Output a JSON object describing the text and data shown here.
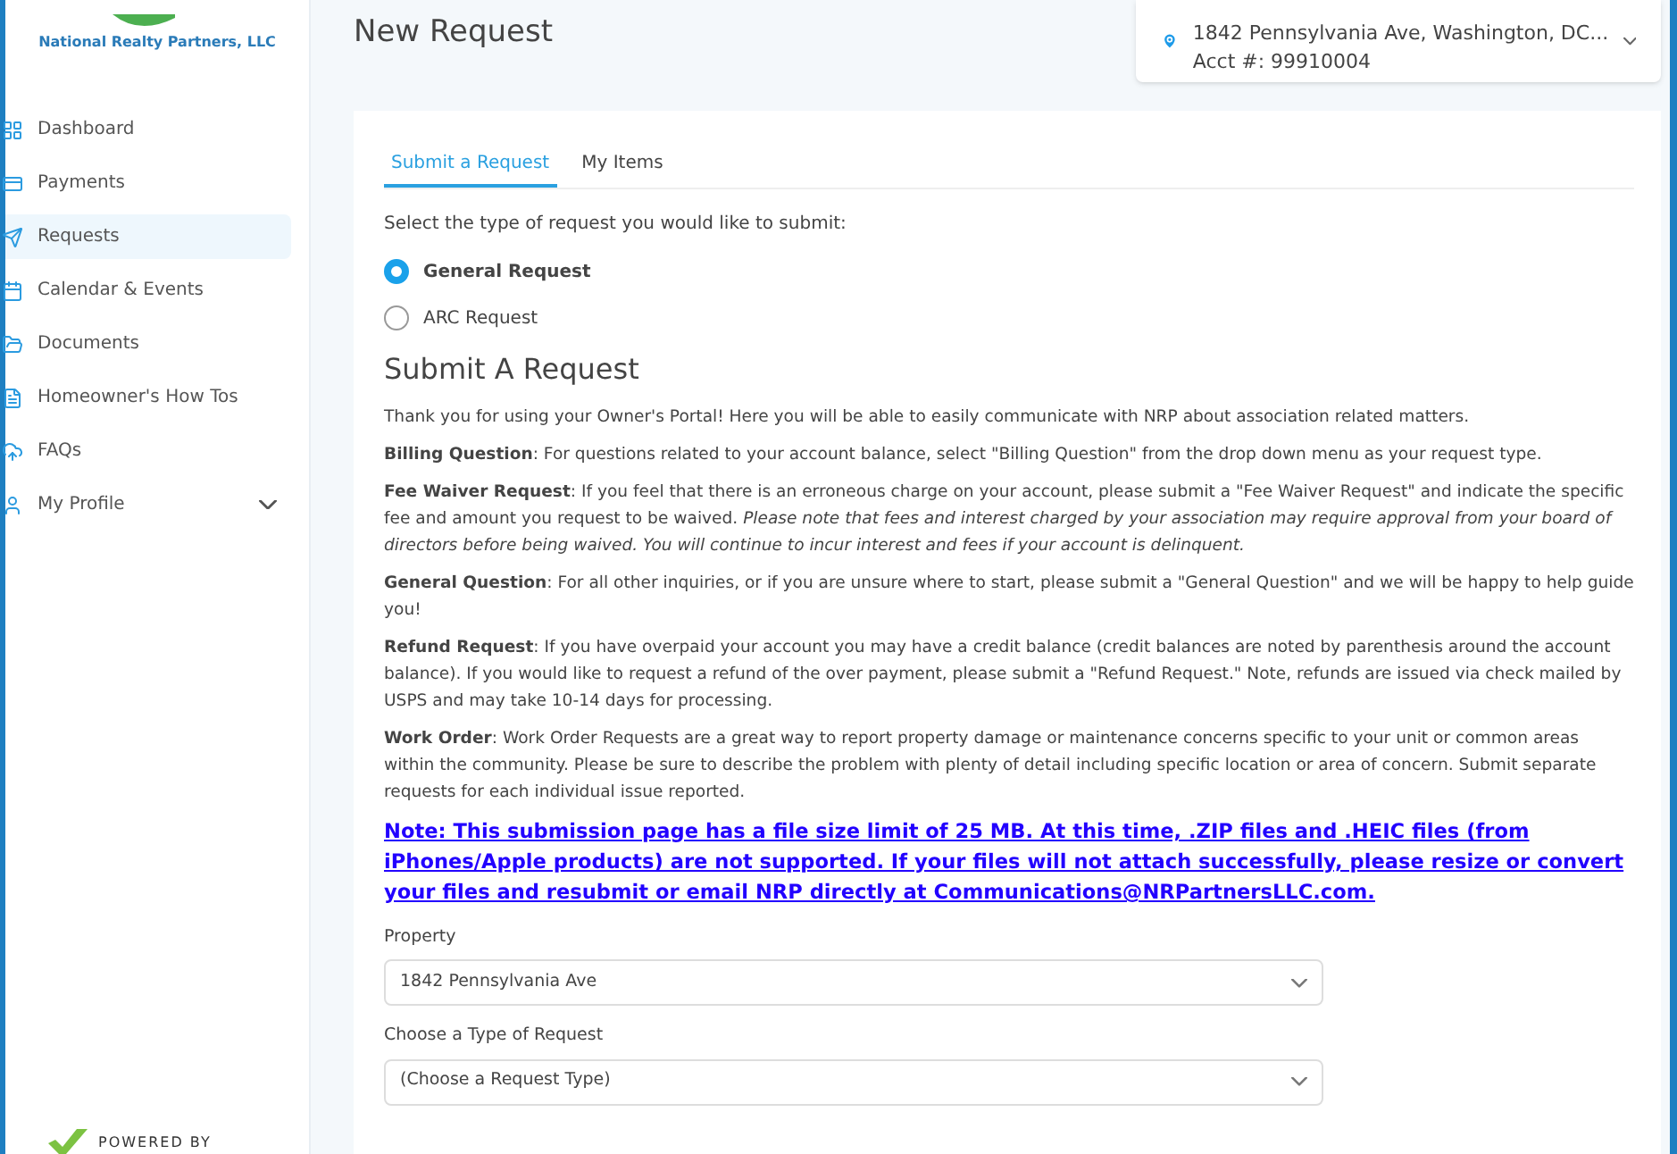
{
  "brand": {
    "company": "National Realty Partners, LLC",
    "powered_by": "POWERED BY"
  },
  "sidebar": {
    "items": [
      {
        "label": "Dashboard",
        "selected": false
      },
      {
        "label": "Payments",
        "selected": false
      },
      {
        "label": "Requests",
        "selected": true
      },
      {
        "label": "Calendar & Events",
        "selected": false
      },
      {
        "label": "Documents",
        "selected": false
      },
      {
        "label": "Homeowner's How Tos",
        "selected": false
      },
      {
        "label": "FAQs",
        "selected": false
      },
      {
        "label": "My Profile",
        "selected": false,
        "expandable": true
      }
    ]
  },
  "header": {
    "title": "New Request"
  },
  "account": {
    "address": "1842 Pennsylvania Ave, Washington, DC...",
    "acct": "Acct #: 99910004"
  },
  "tabs": [
    {
      "label": "Submit a Request",
      "selected": true
    },
    {
      "label": "My Items",
      "selected": false
    }
  ],
  "request_type": {
    "prompt": "Select the type of request you would like to submit:",
    "options": [
      {
        "label": "General Request",
        "selected": true
      },
      {
        "label": "ARC Request",
        "selected": false
      }
    ]
  },
  "section": {
    "heading": "Submit A Request",
    "paragraphs": [
      "Thank you for using your Owner's Portal!  Here you will be able to easily communicate with NRP about association related matters.",
      "**Billing Question**:  For questions related to your account balance, select \"Billing Question\" from the drop down menu as your request type.",
      "**Fee Waiver Request**: If you feel that there is an erroneous charge on  your account, please submit a \"Fee Waiver Request\" and indicate the specific fee and amount you request to be waived.  *Please note that fees and interest charged by your association may require approval from your board of directors before being waived.  You will continue to incur interest and fees if your account is delinquent.*",
      "**General Question**:  For all other inquiries, or if you are unsure where to start, please submit a \"General Question\" and we will be happy to help guide you!",
      "**Refund Request**:  If you have overpaid your account you may have a credit balance (credit balances are noted by parenthesis around the account balance).  If you would like to request a refund of the over payment, please submit a \"Refund Request.\"  Note, refunds are issued via check mailed by USPS and may take 10-14 days for processing.",
      "**Work Order**: Work Order Requests are a great way to report property damage or maintenance concerns specific to your unit or common areas within the community.  Please be sure to describe the problem with plenty of detail including specific location or area of concern.  Submit separate requests for each individual issue reported."
    ],
    "note": "Note: This submission page has a file size limit of 25 MB. At this time, .ZIP files and .HEIC files (from iPhones/Apple products) are not supported. If your files will not attach successfully, please resize or convert your files and resubmit or email NRP directly at Communications@NRPartnersLLC.com."
  },
  "fields": [
    {
      "label": "Property",
      "value": "1842 Pennsylvania Ave"
    },
    {
      "label": "Choose a Type of Request",
      "value": "(Choose a Request Type)"
    }
  ]
}
